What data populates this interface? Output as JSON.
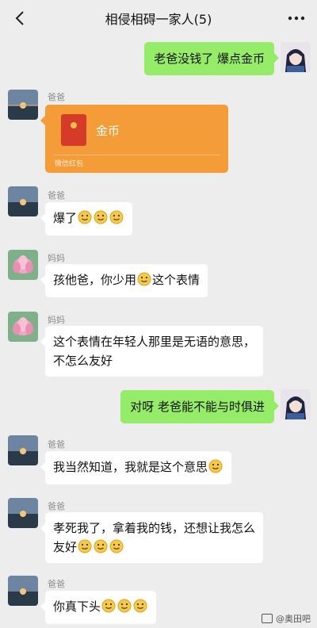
{
  "header": {
    "title": "相侵相碍一家人(5)",
    "back_icon": "chevron-left-icon",
    "more_icon": "more-dots-icon"
  },
  "colors": {
    "background": "#ededed",
    "my_bubble": "#95ec69",
    "other_bubble": "#ffffff",
    "red_packet": "#f39c38"
  },
  "messages": [
    {
      "sender": "me",
      "text": "老爸没钱了 爆点金币"
    },
    {
      "sender": "爸爸",
      "type": "red_packet",
      "label": "金币",
      "footer": "微信红包"
    },
    {
      "sender": "爸爸",
      "text": "爆了",
      "emoji_count": 3
    },
    {
      "sender": "妈妈",
      "text_before": "孩他爸，你少用",
      "text_after": "这个表情"
    },
    {
      "sender": "妈妈",
      "line1": "这个表情在年轻人那里是无语的意思，",
      "line2": "不怎么友好"
    },
    {
      "sender": "me",
      "text": "对呀 老爸能不能与时俱进"
    },
    {
      "sender": "爸爸",
      "text": "我当然知道，我就是这个意思"
    },
    {
      "sender": "爸爸",
      "line1": "孝死我了，拿着我的钱，还想让我怎么",
      "line2": "友好"
    },
    {
      "sender": "爸爸",
      "text": "你真下头"
    }
  ],
  "emoji": "slight-smile-emoji",
  "watermark": "@奥田吧"
}
